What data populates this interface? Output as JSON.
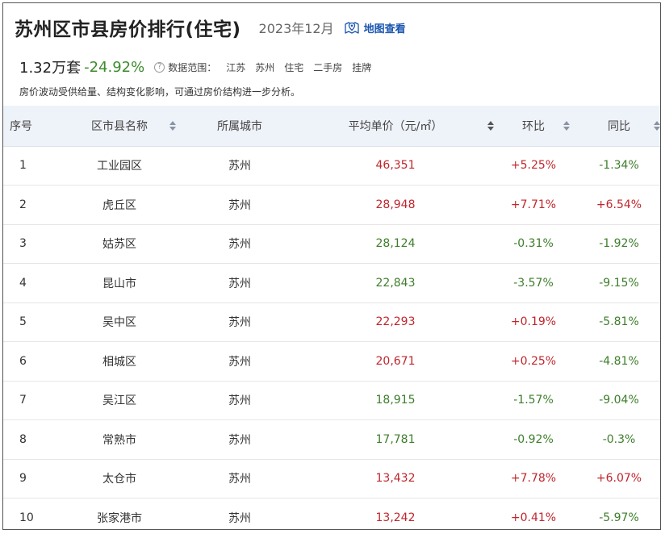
{
  "header": {
    "title": "苏州区市县房价排行(住宅)",
    "date": "2023年12月",
    "map_link": "地图查看"
  },
  "summary": {
    "value": "1.32万套",
    "change": "-24.92%",
    "scope_label": "数据范围：",
    "scope": [
      "江苏",
      "苏州",
      "住宅",
      "二手房",
      "挂牌"
    ]
  },
  "note": "房价波动受供给量、结构变化影响，可通过房价结构进一步分析。",
  "table": {
    "columns": [
      "序号",
      "区市县名称",
      "所属城市",
      "平均单价（元/㎡）",
      "环比",
      "同比"
    ],
    "rows": [
      {
        "rank": "1",
        "name": "工业园区",
        "city": "苏州",
        "price": "46,351",
        "mom": "+5.25%",
        "yoy": "-1.34%"
      },
      {
        "rank": "2",
        "name": "虎丘区",
        "city": "苏州",
        "price": "28,948",
        "mom": "+7.71%",
        "yoy": "+6.54%"
      },
      {
        "rank": "3",
        "name": "姑苏区",
        "city": "苏州",
        "price": "28,124",
        "mom": "-0.31%",
        "yoy": "-1.92%"
      },
      {
        "rank": "4",
        "name": "昆山市",
        "city": "苏州",
        "price": "22,843",
        "mom": "-3.57%",
        "yoy": "-9.15%"
      },
      {
        "rank": "5",
        "name": "吴中区",
        "city": "苏州",
        "price": "22,293",
        "mom": "+0.19%",
        "yoy": "-5.81%"
      },
      {
        "rank": "6",
        "name": "相城区",
        "city": "苏州",
        "price": "20,671",
        "mom": "+0.25%",
        "yoy": "-4.81%"
      },
      {
        "rank": "7",
        "name": "吴江区",
        "city": "苏州",
        "price": "18,915",
        "mom": "-1.57%",
        "yoy": "-9.04%"
      },
      {
        "rank": "8",
        "name": "常熟市",
        "city": "苏州",
        "price": "17,781",
        "mom": "-0.92%",
        "yoy": "-0.3%"
      },
      {
        "rank": "9",
        "name": "太仓市",
        "city": "苏州",
        "price": "13,432",
        "mom": "+7.78%",
        "yoy": "+6.07%"
      },
      {
        "rank": "10",
        "name": "张家港市",
        "city": "苏州",
        "price": "13,242",
        "mom": "+0.41%",
        "yoy": "-5.97%"
      }
    ]
  },
  "colors": {
    "up": "#c0262d",
    "down": "#3d7e2a",
    "header_bg": "#eef2f9",
    "link": "#1a56b0"
  }
}
